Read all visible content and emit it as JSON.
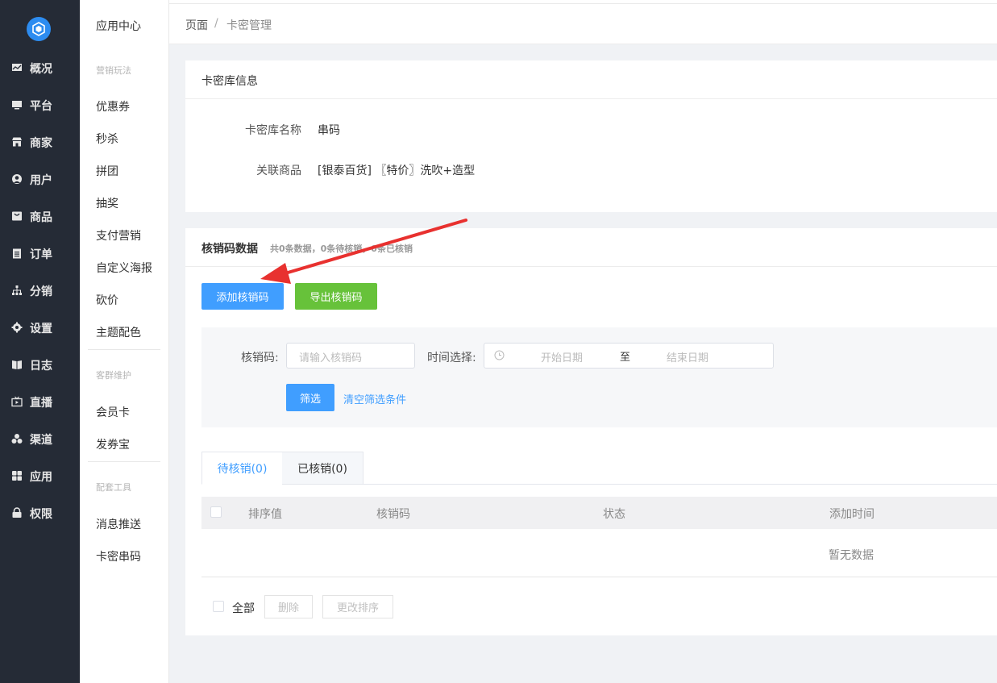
{
  "nav": {
    "items": [
      {
        "label": "概况",
        "icon": "chart-icon"
      },
      {
        "label": "平台",
        "icon": "monitor-icon"
      },
      {
        "label": "商家",
        "icon": "store-icon"
      },
      {
        "label": "用户",
        "icon": "user-icon"
      },
      {
        "label": "商品",
        "icon": "bag-icon"
      },
      {
        "label": "订单",
        "icon": "clipboard-icon"
      },
      {
        "label": "分销",
        "icon": "sitemap-icon"
      },
      {
        "label": "设置",
        "icon": "gear-icon"
      },
      {
        "label": "日志",
        "icon": "book-icon"
      },
      {
        "label": "直播",
        "icon": "tv-icon"
      },
      {
        "label": "渠道",
        "icon": "cluster-icon"
      },
      {
        "label": "应用",
        "icon": "grid-icon"
      },
      {
        "label": "权限",
        "icon": "lock-icon"
      }
    ]
  },
  "submenu": {
    "title": "应用中心",
    "group1": "营销玩法",
    "group1_items": [
      "优惠券",
      "秒杀",
      "拼团",
      "抽奖",
      "支付营销",
      "自定义海报",
      "砍价",
      "主题配色"
    ],
    "group2": "客群维护",
    "group2_items": [
      "会员卡",
      "发券宝"
    ],
    "group3": "配套工具",
    "group3_items": [
      "消息推送",
      "卡密串码"
    ]
  },
  "breadcrumb": {
    "root": "页面",
    "sep": "/",
    "current": "卡密管理"
  },
  "info_card": {
    "title": "卡密库信息",
    "name_label": "卡密库名称",
    "name_value": "串码",
    "goods_label": "关联商品",
    "goods_value": "[银泰百货] 〖特价〗洗吹+造型"
  },
  "codes_card": {
    "title": "核销码数据",
    "summary": "共0条数据，0条待核销，0条已核销",
    "add_button": "添加核销码",
    "export_button": "导出核销码",
    "filter": {
      "code_label": "核销码:",
      "code_placeholder": "请输入核销码",
      "time_label": "时间选择:",
      "start_placeholder": "开始日期",
      "to": "至",
      "end_placeholder": "结束日期",
      "filter_button": "筛选",
      "clear_link": "清空筛选条件"
    },
    "tabs": [
      {
        "label": "待核销(0)",
        "active": true
      },
      {
        "label": "已核销(0)",
        "active": false
      }
    ],
    "table": {
      "columns": [
        "排序值",
        "核销码",
        "状态",
        "添加时间"
      ],
      "empty": "暂无数据"
    },
    "footer": {
      "all_label": "全部",
      "delete_button": "删除",
      "sort_button": "更改排序"
    }
  },
  "colors": {
    "primary": "#409eff",
    "success": "#67c23a",
    "nav_bg": "#252b36"
  }
}
